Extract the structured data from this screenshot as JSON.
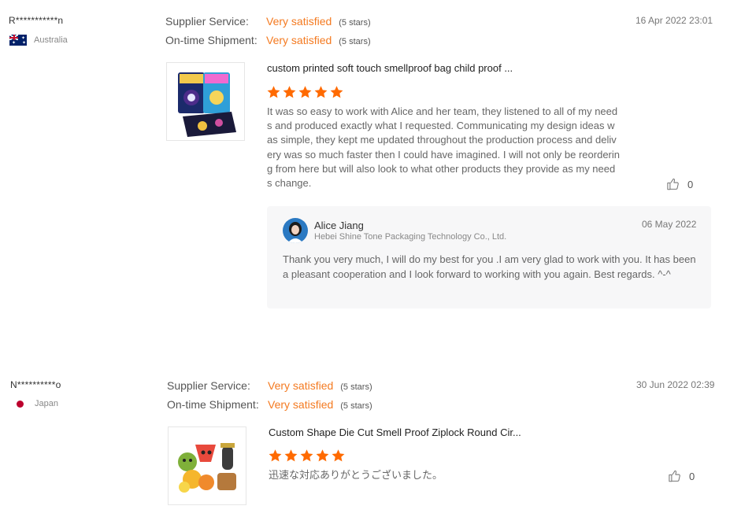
{
  "reviews": [
    {
      "buyer": "R***********n",
      "country": "Australia",
      "supplier_service_label": "Supplier Service:",
      "supplier_service_value": "Very satisfied",
      "supplier_service_stars": "(5 stars)",
      "shipment_label": "On-time Shipment:",
      "shipment_value": "Very satisfied",
      "shipment_stars": "(5 stars)",
      "date": "16 Apr 2022 23:01",
      "product_title": "custom printed soft touch smellproof bag child proof ...",
      "rating": 5,
      "comment": "It was so easy to work with Alice and her team, they listened to all of my needs and produced exactly what I requested. Communicating my design ideas was simple, they kept me updated throughout the production process and delivery was so much faster then I could have imagined. I will not only be reordering from here but will also look to what other products they provide as my needs change.",
      "likes": "0",
      "reply": {
        "name": "Alice Jiang",
        "company": "Hebei Shine Tone Packaging Technology Co., Ltd.",
        "date": "06 May 2022",
        "text": "Thank you very much,  I will do my best for you .I am very glad to work with you. It has been a pleasant cooperation and I look forward to working with you again. Best regards. ^-^"
      }
    },
    {
      "buyer": "N**********o",
      "country": "Japan",
      "supplier_service_label": "Supplier Service:",
      "supplier_service_value": "Very satisfied",
      "supplier_service_stars": "(5 stars)",
      "shipment_label": "On-time Shipment:",
      "shipment_value": "Very satisfied",
      "shipment_stars": "(5 stars)",
      "date": "30 Jun 2022 02:39",
      "product_title": "Custom Shape Die Cut Smell Proof Ziplock Round Cir...",
      "rating": 5,
      "comment": "迅速な対応ありがとうございました。",
      "likes": "0"
    }
  ],
  "colors": {
    "accent": "#f47a20",
    "star": "#ff6a00",
    "reply_bg": "#f7f7f8"
  },
  "icons": {
    "like": "thumbs-up-icon",
    "star": "star-icon"
  }
}
